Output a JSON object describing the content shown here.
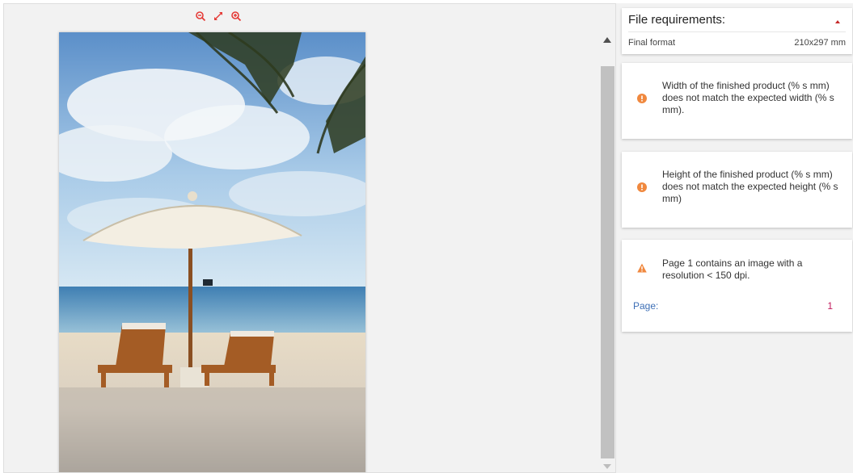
{
  "viewer": {
    "zoom_out_icon": "zoom-out-icon",
    "fit_icon": "expand-icon",
    "zoom_in_icon": "zoom-in-icon",
    "accent_color": "#e53935"
  },
  "panel": {
    "requirements": {
      "title": "File requirements:",
      "final_format_label": "Final format",
      "final_format_value": "210x297 mm"
    },
    "messages": [
      {
        "severity": "error",
        "text": "Width of the finished product (% s mm) does not match the expected width (% s mm)."
      },
      {
        "severity": "error",
        "text": "Height of the finished product (% s mm) does not match the expected height (% s mm)"
      },
      {
        "severity": "warning",
        "text": "Page 1 contains an image with a resolution < 150 dpi.",
        "page_label": "Page:",
        "page_value": "1"
      }
    ],
    "icon_color": "#f0883e"
  }
}
